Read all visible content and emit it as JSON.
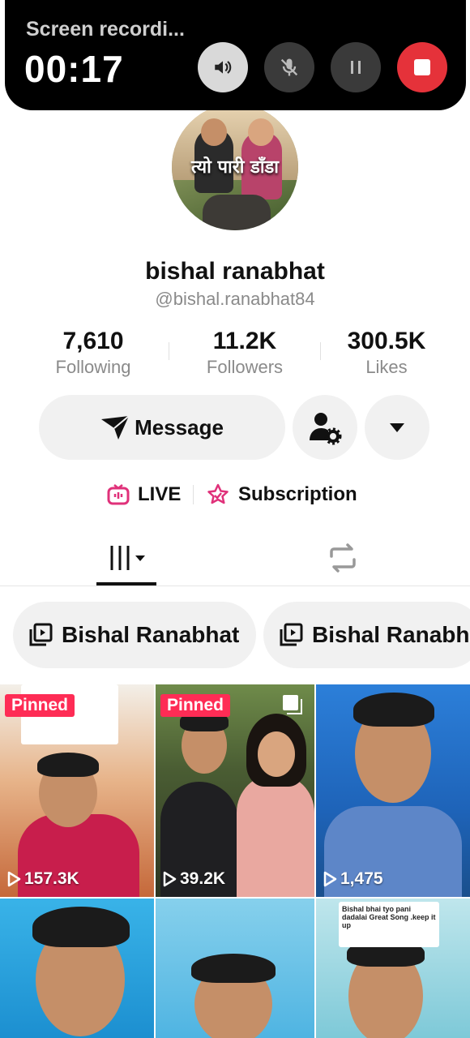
{
  "recording": {
    "title": "Screen recordi...",
    "time": "00:17",
    "buttons": [
      "speaker-icon",
      "mic-off-icon",
      "pause-icon",
      "stop-icon"
    ]
  },
  "profile": {
    "avatar_text": "त्यो पारी डाँडा",
    "name": "bishal ranabhat",
    "handle": "@bishal.ranabhat84"
  },
  "stats": [
    {
      "value": "7,610",
      "label": "Following"
    },
    {
      "value": "11.2K",
      "label": "Followers"
    },
    {
      "value": "300.5K",
      "label": "Likes"
    }
  ],
  "actions": {
    "message_label": "Message"
  },
  "features": {
    "live_label": "LIVE",
    "subscription_label": "Subscription"
  },
  "playlists": [
    {
      "label": "Bishal Ranabhat"
    },
    {
      "label": "Bishal Ranabh"
    }
  ],
  "videos": [
    {
      "pinned": "Pinned",
      "views": "157.3K"
    },
    {
      "pinned": "Pinned",
      "views": "39.2K"
    },
    {
      "views": "1,475"
    },
    {},
    {},
    {
      "comment": "Bishal bhai tyo pani dadalai Great Song .keep it up"
    }
  ],
  "colors": {
    "accent": "#fe2c55",
    "stop": "#e5323a",
    "live": "#e0317a"
  }
}
